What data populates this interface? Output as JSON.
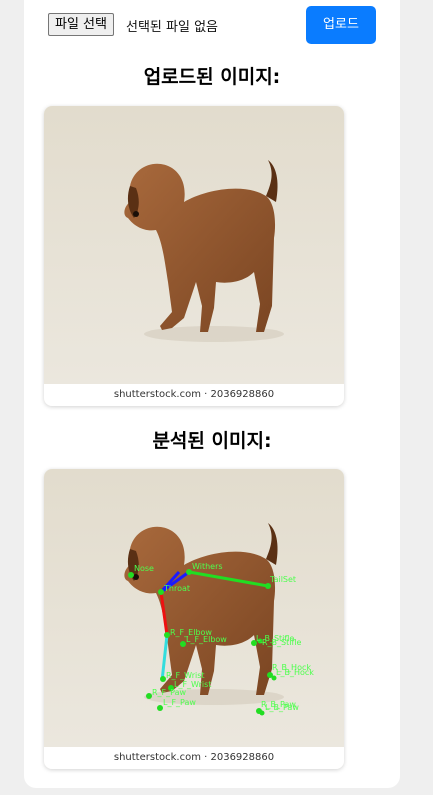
{
  "upload": {
    "choose_file_label": "파일 선택",
    "file_status": "선택된 파일 없음",
    "upload_button": "업로드"
  },
  "sections": {
    "uploaded_title": "업로드된 이미지:",
    "analyzed_title": "분석된 이미지:"
  },
  "images": {
    "watermark": "shutterstock.com · 2036928860"
  },
  "keypoints": {
    "nose": "Nose",
    "withers": "Withers",
    "throat": "Throat",
    "tailset": "TailSet",
    "r_f_elbow": "R_F_Elbow",
    "l_f_elbow": "L_F_Elbow",
    "l_b_stifle": "L_B_Stifle",
    "r_b_stifle": "R_B_Stifle",
    "r_b_hock": "R_B_Hock",
    "l_b_hock": "L_B_Hock",
    "r_f_wrist": "R_F_Wrist",
    "l_f_wrist": "L_F_Wrist",
    "r_f_paw": "R_F_Paw",
    "l_f_paw": "L_F_Paw",
    "r_b_paw": "R_B_Paw",
    "l_b_paw": "L_B_Paw"
  },
  "colors": {
    "accent": "#0a7cff",
    "keypoint": "#22dd22",
    "limb_neck": "#1a1aff",
    "limb_upper_leg": "#ee1111",
    "limb_lower_leg": "#33dddd",
    "limb_back": "#22dd22"
  }
}
